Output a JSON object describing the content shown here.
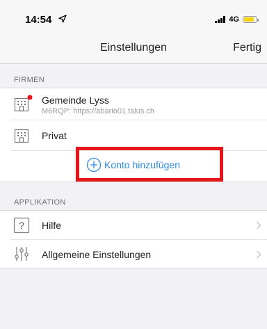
{
  "status_bar": {
    "time": "14:54",
    "network": "4G",
    "battery_level": 0.8,
    "battery_color": "#f5d20a"
  },
  "nav": {
    "title": "Einstellungen",
    "done_label": "Fertig"
  },
  "sections": {
    "firmen": {
      "header": "FIRMEN",
      "items": [
        {
          "label": "Gemeinde Lyss",
          "subtitle": "M6RQP: https://abario01.talus.ch",
          "icon": "building-icon",
          "status_dot_color": "#e8141a"
        },
        {
          "label": "Privat",
          "icon": "building-icon"
        }
      ],
      "add_label": "Konto hinzufügen"
    },
    "applikation": {
      "header": "APPLIKATION",
      "items": [
        {
          "label": "Hilfe",
          "icon": "help-icon"
        },
        {
          "label": "Allgemeine Einstellungen",
          "icon": "sliders-icon"
        }
      ]
    }
  },
  "colors": {
    "accent": "#2b8be6",
    "highlight": "#e8141a",
    "background": "#f2f2f6"
  }
}
